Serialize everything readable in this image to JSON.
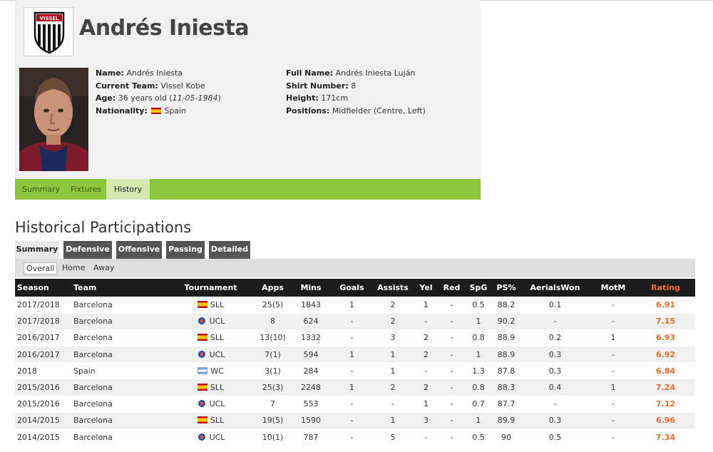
{
  "player": {
    "name": "Andrés Iniesta",
    "club_logo_text": "VISSEL",
    "details_left": [
      {
        "label": "Name:",
        "value": "Andrés Iniesta"
      },
      {
        "label": "Current Team:",
        "value": "Vissel Kobe"
      },
      {
        "label": "Age:",
        "value": "36 years old (",
        "value_em": "11-05-1984",
        "value_end": ")"
      },
      {
        "label": "Nationality:",
        "value": "Spain",
        "flag": "spain-flag"
      }
    ],
    "details_right": [
      {
        "label": "Full Name:",
        "value": "Andrés Iniesta Luján"
      },
      {
        "label": "Shirt Number:",
        "value": "8"
      },
      {
        "label": "Height:",
        "value": "171cm"
      },
      {
        "label": "Positions:",
        "value": "Midfielder (Centre, Left)"
      }
    ]
  },
  "nav": [
    "Summary",
    "Fixtures",
    "History"
  ],
  "nav_active": "History",
  "section_title": "Historical Participations",
  "subtabs": [
    "Summary",
    "Defensive",
    "Offensive",
    "Passing",
    "Detailed"
  ],
  "filters": [
    "Overall",
    "Home",
    "Away"
  ],
  "table": {
    "headers": [
      "Season",
      "Team",
      "Tournament",
      "Apps",
      "Mins",
      "Goals",
      "Assists",
      "Yel",
      "Red",
      "SpG",
      "PS%",
      "AerialsWon",
      "MotM",
      "Rating"
    ],
    "rows": [
      {
        "season": "2017/2018",
        "team": "Barcelona",
        "flag": "es",
        "tournament": "SLL",
        "apps": "25(5)",
        "mins": "1843",
        "goals": "1",
        "assists": "2",
        "yel": "1",
        "red": "-",
        "spg": "0.5",
        "ps": "88.2",
        "aerials": "0.1",
        "motm": "-",
        "rating": "6.91"
      },
      {
        "season": "2017/2018",
        "team": "Barcelona",
        "flag": "eu",
        "tournament": "UCL",
        "apps": "8",
        "mins": "624",
        "goals": "-",
        "assists": "2",
        "yel": "-",
        "red": "-",
        "spg": "1",
        "ps": "90.2",
        "aerials": "-",
        "motm": "-",
        "rating": "7.15"
      },
      {
        "season": "2016/2017",
        "team": "Barcelona",
        "flag": "es",
        "tournament": "SLL",
        "apps": "13(10)",
        "mins": "1332",
        "goals": "-",
        "assists": "3",
        "yel": "2",
        "red": "-",
        "spg": "0.8",
        "ps": "88.9",
        "aerials": "0.2",
        "motm": "1",
        "rating": "6.93"
      },
      {
        "season": "2016/2017",
        "team": "Barcelona",
        "flag": "eu",
        "tournament": "UCL",
        "apps": "7(1)",
        "mins": "594",
        "goals": "1",
        "assists": "1",
        "yel": "2",
        "red": "-",
        "spg": "1",
        "ps": "88.9",
        "aerials": "0.3",
        "motm": "-",
        "rating": "6.92"
      },
      {
        "season": "2018",
        "team": "Spain",
        "flag": "wc",
        "tournament": "WC",
        "apps": "3(1)",
        "mins": "284",
        "goals": "-",
        "assists": "1",
        "yel": "-",
        "red": "-",
        "spg": "1.3",
        "ps": "87.8",
        "aerials": "0.3",
        "motm": "-",
        "rating": "6.84"
      },
      {
        "season": "2015/2016",
        "team": "Barcelona",
        "flag": "es",
        "tournament": "SLL",
        "apps": "25(3)",
        "mins": "2248",
        "goals": "1",
        "assists": "2",
        "yel": "2",
        "red": "-",
        "spg": "0.8",
        "ps": "88.3",
        "aerials": "0.4",
        "motm": "1",
        "rating": "7.24"
      },
      {
        "season": "2015/2016",
        "team": "Barcelona",
        "flag": "eu",
        "tournament": "UCL",
        "apps": "7",
        "mins": "553",
        "goals": "-",
        "assists": "-",
        "yel": "1",
        "red": "-",
        "spg": "0.7",
        "ps": "87.7",
        "aerials": "-",
        "motm": "-",
        "rating": "7.12"
      },
      {
        "season": "2014/2015",
        "team": "Barcelona",
        "flag": "es",
        "tournament": "SLL",
        "apps": "19(5)",
        "mins": "1590",
        "goals": "-",
        "assists": "1",
        "yel": "3",
        "red": "-",
        "spg": "1",
        "ps": "89.9",
        "aerials": "0.3",
        "motm": "-",
        "rating": "6.96"
      },
      {
        "season": "2014/2015",
        "team": "Barcelona",
        "flag": "eu",
        "tournament": "UCL",
        "apps": "10(1)",
        "mins": "787",
        "goals": "-",
        "assists": "5",
        "yel": "-",
        "red": "-",
        "spg": "0.5",
        "ps": "90",
        "aerials": "0.5",
        "motm": "-",
        "rating": "7.34"
      }
    ]
  },
  "colors": {
    "nav_green": "#8cc63f",
    "rating_orange": "#f26b2a",
    "header_black": "#1c1c1c"
  }
}
